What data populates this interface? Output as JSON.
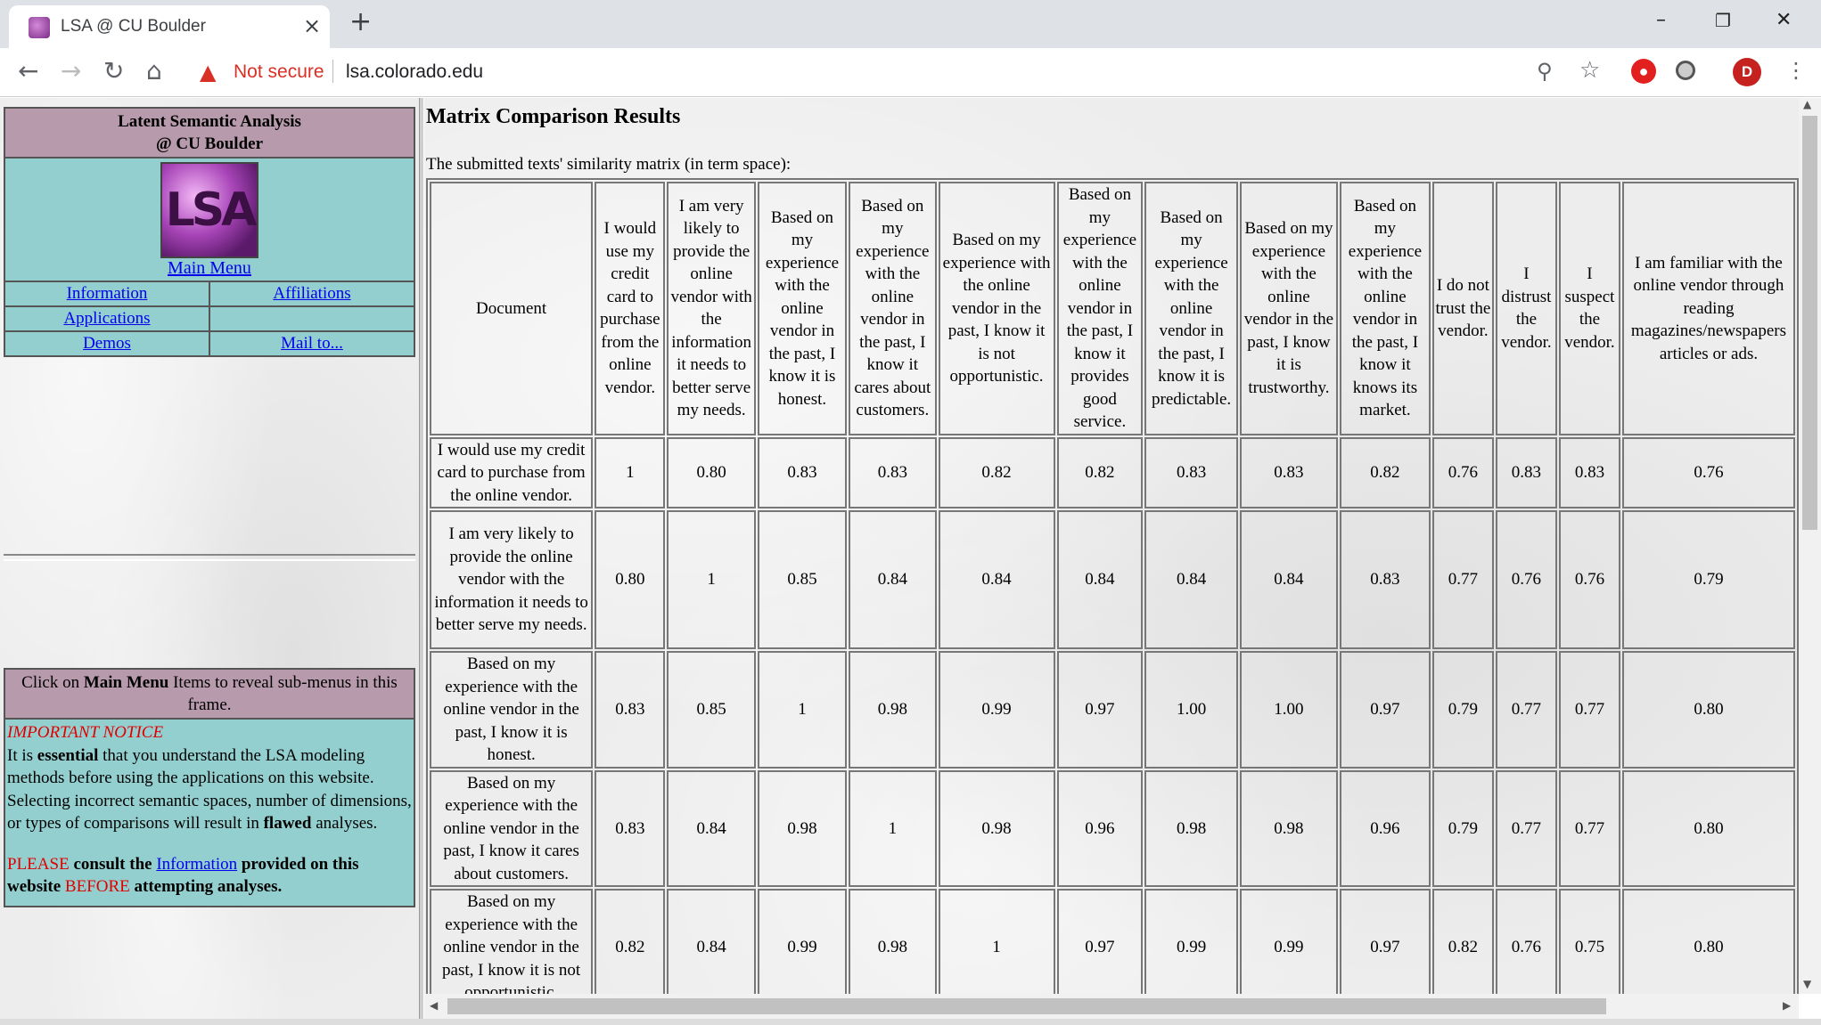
{
  "browser": {
    "tab_title": "LSA @ CU Boulder",
    "tab_close": "×",
    "new_tab": "+",
    "not_secure": "Not secure",
    "url": "lsa.colorado.edu",
    "avatar_letter": "D",
    "window_min": "–",
    "window_max": "❐",
    "window_close": "✕",
    "icons": [
      "back-icon",
      "forward-icon",
      "reload-icon",
      "home-icon",
      "warning-icon",
      "zoom-icon",
      "star-icon",
      "extension-icon",
      "menu-icon"
    ]
  },
  "sidebar": {
    "header_line1": "Latent Semantic Analysis",
    "header_line2": "@ CU Boulder",
    "logo_text": "LSA",
    "main_menu": "Main Menu",
    "links": {
      "information": "Information",
      "affiliations": "Affiliations",
      "applications": "Applications",
      "demos": "Demos",
      "mail_to": "Mail to..."
    },
    "notice_pre": "Click on ",
    "notice_bold": "Main Menu",
    "notice_post": " Items to reveal sub-menus in this frame.",
    "important_title": "IMPORTANT NOTICE",
    "notice_p1_a": "It is ",
    "notice_p1_b": "essential",
    "notice_p1_c": " that you understand the LSA modeling methods before using the applications on this website. Selecting incorrect semantic spaces, number of dimensions, or types of comparisons will result in ",
    "notice_p1_d": "flawed",
    "notice_p1_e": " analyses.",
    "notice_p2_a": "PLEASE",
    "notice_p2_b": " consult the ",
    "notice_p2_link": "Information",
    "notice_p2_c": " provided on this website ",
    "notice_p2_d": "BEFORE",
    "notice_p2_e": " attempting analyses.",
    "colors": {
      "mauve": "#b79aab",
      "teal": "#94cfcf",
      "notice_red": "#e00000"
    }
  },
  "main": {
    "title": "Matrix Comparison Results",
    "caption": "The submitted texts' similarity matrix (in term space):",
    "columns": [
      "Document",
      "I would use my credit card to purchase from the online vendor.",
      "I am very likely to provide the online vendor with the information it needs to better serve my needs.",
      "Based on my experience with the online vendor in the past, I know it is honest.",
      "Based on my experience with the online vendor in the past, I know it cares about customers.",
      "Based on my experience with the online vendor in the past, I know it is not opportunistic.",
      "Based on my experience with the online vendor in the past, I know it provides good service.",
      "Based on my experience with the online vendor in the past, I know it is predictable.",
      "Based on my experience with the online vendor in the past, I know it is trustworthy.",
      "Based on my experience with the online vendor in the past, I know it knows its market.",
      "I do not trust the vendor.",
      "I distrust the vendor.",
      "I suspect the vendor.",
      "I am familiar with the online vendor through reading magazines/newspapers articles or ads."
    ],
    "rows": [
      {
        "label": "I would use my credit card to purchase from the online vendor.",
        "values": [
          "1",
          "0.80",
          "0.83",
          "0.83",
          "0.82",
          "0.82",
          "0.83",
          "0.83",
          "0.82",
          "0.76",
          "0.83",
          "0.83",
          "0.76"
        ]
      },
      {
        "label": "I am very likely to provide the online vendor with the information it needs to better serve my needs.",
        "values": [
          "0.80",
          "1",
          "0.85",
          "0.84",
          "0.84",
          "0.84",
          "0.84",
          "0.84",
          "0.83",
          "0.77",
          "0.76",
          "0.76",
          "0.79"
        ]
      },
      {
        "label": "Based on my experience with the online vendor in the past, I know it is honest.",
        "values": [
          "0.83",
          "0.85",
          "1",
          "0.98",
          "0.99",
          "0.97",
          "1.00",
          "1.00",
          "0.97",
          "0.79",
          "0.77",
          "0.77",
          "0.80"
        ]
      },
      {
        "label": "Based on my experience with the online vendor in the past, I know it cares about customers.",
        "values": [
          "0.83",
          "0.84",
          "0.98",
          "1",
          "0.98",
          "0.96",
          "0.98",
          "0.98",
          "0.96",
          "0.79",
          "0.77",
          "0.77",
          "0.80"
        ]
      },
      {
        "label": "Based on my experience with the online vendor in the past, I know it is not opportunistic.",
        "values": [
          "0.82",
          "0.84",
          "0.99",
          "0.98",
          "1",
          "0.97",
          "0.99",
          "0.99",
          "0.97",
          "0.82",
          "0.76",
          "0.75",
          "0.80"
        ]
      }
    ]
  }
}
